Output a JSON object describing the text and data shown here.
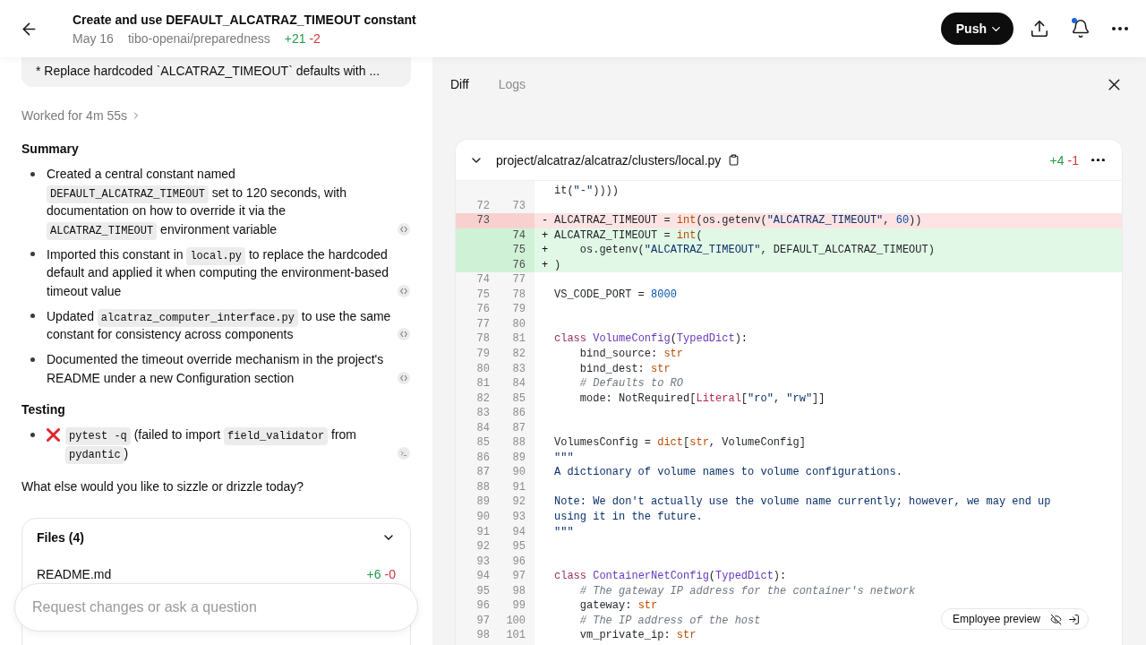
{
  "header": {
    "title": "Create and use DEFAULT_ALCATRAZ_TIMEOUT constant",
    "date": "May 16",
    "repo": "tibo-openai/preparedness",
    "additions": "+21",
    "deletions": "-2",
    "push_label": "Push",
    "notifications_unread": true
  },
  "chat": {
    "message_preview": "* Replace hardcoded `ALCATRAZ_TIMEOUT` defaults with ...",
    "worked_for": "Worked for 4m 55s",
    "sections": [
      {
        "heading": "Summary",
        "items": [
          {
            "segments": [
              {
                "kind": "text",
                "text": "Created a central constant named "
              },
              {
                "kind": "code",
                "text": "DEFAULT_ALCATRAZ_TIMEOUT"
              },
              {
                "kind": "text",
                "text": " set to 120 seconds, with documentation on how to override it via the "
              },
              {
                "kind": "code",
                "text": "ALCATRAZ_TIMEOUT"
              },
              {
                "kind": "text",
                "text": " environment variable"
              }
            ],
            "citation": {
              "kind": "code"
            }
          },
          {
            "segments": [
              {
                "kind": "text",
                "text": "Imported this constant in "
              },
              {
                "kind": "code",
                "text": "local.py"
              },
              {
                "kind": "text",
                "text": " to replace the hardcoded default and applied it when computing the environment-based timeout value"
              }
            ],
            "citation": {
              "kind": "code"
            }
          },
          {
            "segments": [
              {
                "kind": "text",
                "text": "Updated "
              },
              {
                "kind": "code",
                "text": "alcatraz_computer_interface.py"
              },
              {
                "kind": "text",
                "text": " to use the same constant for consistency across components"
              }
            ],
            "citation": {
              "kind": "code"
            }
          },
          {
            "segments": [
              {
                "kind": "text",
                "text": "Documented the timeout override mechanism in the project's README under a new Configuration section"
              }
            ],
            "citation": {
              "kind": "code"
            }
          }
        ]
      },
      {
        "heading": "Testing",
        "items": [
          {
            "failed": true,
            "segments": [
              {
                "kind": "code",
                "text": "pytest -q"
              },
              {
                "kind": "text",
                "text": " (failed to import "
              },
              {
                "kind": "code",
                "text": "field_validator"
              },
              {
                "kind": "text",
                "text": " from "
              },
              {
                "kind": "code",
                "text": "pydantic"
              },
              {
                "kind": "text",
                "text": ")"
              }
            ],
            "citation": {
              "kind": "terminal"
            }
          }
        ]
      }
    ],
    "prompt": "What else would you like to sizzle or drizzle today?",
    "files": {
      "title": "Files (4)",
      "expanded": true,
      "items": [
        {
          "name": "README.md",
          "additions": "+6",
          "deletions": "-0"
        }
      ]
    },
    "composer": {
      "placeholder": "Request changes or ask a question"
    }
  },
  "diff_panel": {
    "tabs": [
      {
        "label": "Diff",
        "selected": true
      },
      {
        "label": "Logs",
        "selected": false
      }
    ],
    "file": {
      "path": "project/alcatraz/alcatraz/clusters/local.py",
      "expanded": true,
      "additions": "+4",
      "deletions": "-1",
      "lines": [
        {
          "kind": "context",
          "tokens": [
            {
              "text": "it(",
              "kind": "plain"
            },
            {
              "text": "\"-\"",
              "kind": "string"
            },
            {
              "text": "))))",
              "kind": "plain"
            }
          ]
        },
        {
          "old": "72",
          "new": "73",
          "kind": "context"
        },
        {
          "old": "73",
          "kind": "removed",
          "sign": "-",
          "tokens": [
            {
              "text": "ALCATRAZ_TIMEOUT = ",
              "kind": "plain"
            },
            {
              "text": "int",
              "kind": "builtin"
            },
            {
              "text": "(os.getenv(",
              "kind": "plain"
            },
            {
              "text": "\"ALCATRAZ_TIMEOUT\"",
              "kind": "string"
            },
            {
              "text": ", ",
              "kind": "plain"
            },
            {
              "text": "60",
              "kind": "number"
            },
            {
              "text": "))",
              "kind": "plain"
            }
          ]
        },
        {
          "new": "74",
          "kind": "added",
          "sign": "+",
          "tokens": [
            {
              "text": "ALCATRAZ_TIMEOUT = ",
              "kind": "plain"
            },
            {
              "text": "int",
              "kind": "builtin"
            },
            {
              "text": "(",
              "kind": "plain"
            }
          ]
        },
        {
          "new": "75",
          "kind": "added",
          "sign": "+",
          "tokens": [
            {
              "text": "    os.getenv(",
              "kind": "plain"
            },
            {
              "text": "\"ALCATRAZ_TIMEOUT\"",
              "kind": "string"
            },
            {
              "text": ", DEFAULT_ALCATRAZ_TIMEOUT)",
              "kind": "plain"
            }
          ]
        },
        {
          "new": "76",
          "kind": "added",
          "sign": "+",
          "tokens": [
            {
              "text": ")",
              "kind": "plain"
            }
          ]
        },
        {
          "old": "74",
          "new": "77",
          "kind": "context"
        },
        {
          "old": "75",
          "new": "78",
          "kind": "context",
          "tokens": [
            {
              "text": "VS_CODE_PORT = ",
              "kind": "plain"
            },
            {
              "text": "8000",
              "kind": "number"
            }
          ]
        },
        {
          "old": "76",
          "new": "79",
          "kind": "context"
        },
        {
          "old": "77",
          "new": "80",
          "kind": "context"
        },
        {
          "old": "78",
          "new": "81",
          "kind": "context",
          "tokens": [
            {
              "text": "class ",
              "kind": "keyword"
            },
            {
              "text": "VolumeConfig",
              "kind": "classname"
            },
            {
              "text": "(",
              "kind": "plain"
            },
            {
              "text": "TypedDict",
              "kind": "classname"
            },
            {
              "text": "):",
              "kind": "plain"
            }
          ]
        },
        {
          "old": "79",
          "new": "82",
          "kind": "context",
          "tokens": [
            {
              "text": "    bind_source: ",
              "kind": "plain"
            },
            {
              "text": "str",
              "kind": "builtin"
            }
          ]
        },
        {
          "old": "80",
          "new": "83",
          "kind": "context",
          "tokens": [
            {
              "text": "    bind_dest: ",
              "kind": "plain"
            },
            {
              "text": "str",
              "kind": "builtin"
            }
          ]
        },
        {
          "old": "81",
          "new": "84",
          "kind": "context",
          "tokens": [
            {
              "text": "    # Defaults to RO",
              "kind": "comment"
            }
          ]
        },
        {
          "old": "82",
          "new": "85",
          "kind": "context",
          "tokens": [
            {
              "text": "    mode: NotRequired[",
              "kind": "plain"
            },
            {
              "text": "Literal",
              "kind": "type"
            },
            {
              "text": "[",
              "kind": "plain"
            },
            {
              "text": "\"ro\"",
              "kind": "string"
            },
            {
              "text": ", ",
              "kind": "plain"
            },
            {
              "text": "\"rw\"",
              "kind": "string"
            },
            {
              "text": "]]",
              "kind": "plain"
            }
          ]
        },
        {
          "old": "83",
          "new": "86",
          "kind": "context"
        },
        {
          "old": "84",
          "new": "87",
          "kind": "context"
        },
        {
          "old": "85",
          "new": "88",
          "kind": "context",
          "tokens": [
            {
              "text": "VolumesConfig = ",
              "kind": "plain"
            },
            {
              "text": "dict",
              "kind": "builtin"
            },
            {
              "text": "[",
              "kind": "plain"
            },
            {
              "text": "str",
              "kind": "builtin"
            },
            {
              "text": ", VolumeConfig]",
              "kind": "plain"
            }
          ]
        },
        {
          "old": "86",
          "new": "89",
          "kind": "context",
          "tokens": [
            {
              "text": "\"\"\"",
              "kind": "string"
            }
          ]
        },
        {
          "old": "87",
          "new": "90",
          "kind": "context",
          "tokens": [
            {
              "text": "A dictionary of volume names to volume configurations.",
              "kind": "string"
            }
          ]
        },
        {
          "old": "88",
          "new": "91",
          "kind": "context"
        },
        {
          "old": "89",
          "new": "92",
          "kind": "context",
          "tokens": [
            {
              "text": "Note: We don't actually use the volume name currently; however, we may end up",
              "kind": "string"
            }
          ]
        },
        {
          "old": "90",
          "new": "93",
          "kind": "context",
          "tokens": [
            {
              "text": "using it in the future.",
              "kind": "string"
            }
          ]
        },
        {
          "old": "91",
          "new": "94",
          "kind": "context",
          "tokens": [
            {
              "text": "\"\"\"",
              "kind": "string"
            }
          ]
        },
        {
          "old": "92",
          "new": "95",
          "kind": "context"
        },
        {
          "old": "93",
          "new": "96",
          "kind": "context"
        },
        {
          "old": "94",
          "new": "97",
          "kind": "context",
          "tokens": [
            {
              "text": "class ",
              "kind": "keyword"
            },
            {
              "text": "ContainerNetConfig",
              "kind": "classname"
            },
            {
              "text": "(",
              "kind": "plain"
            },
            {
              "text": "TypedDict",
              "kind": "classname"
            },
            {
              "text": "):",
              "kind": "plain"
            }
          ]
        },
        {
          "old": "95",
          "new": "98",
          "kind": "context",
          "tokens": [
            {
              "text": "    # The gateway IP address for the container's network",
              "kind": "comment"
            }
          ]
        },
        {
          "old": "96",
          "new": "99",
          "kind": "context",
          "tokens": [
            {
              "text": "    gateway: ",
              "kind": "plain"
            },
            {
              "text": "str",
              "kind": "builtin"
            }
          ]
        },
        {
          "old": "97",
          "new": "100",
          "kind": "context",
          "tokens": [
            {
              "text": "    # The IP address of the host",
              "kind": "comment"
            }
          ]
        },
        {
          "old": "98",
          "new": "101",
          "kind": "context",
          "tokens": [
            {
              "text": "    vm_private_ip: ",
              "kind": "plain"
            },
            {
              "text": "str",
              "kind": "builtin"
            }
          ]
        }
      ]
    }
  },
  "preview_toolbar": {
    "label": "Employee preview"
  }
}
